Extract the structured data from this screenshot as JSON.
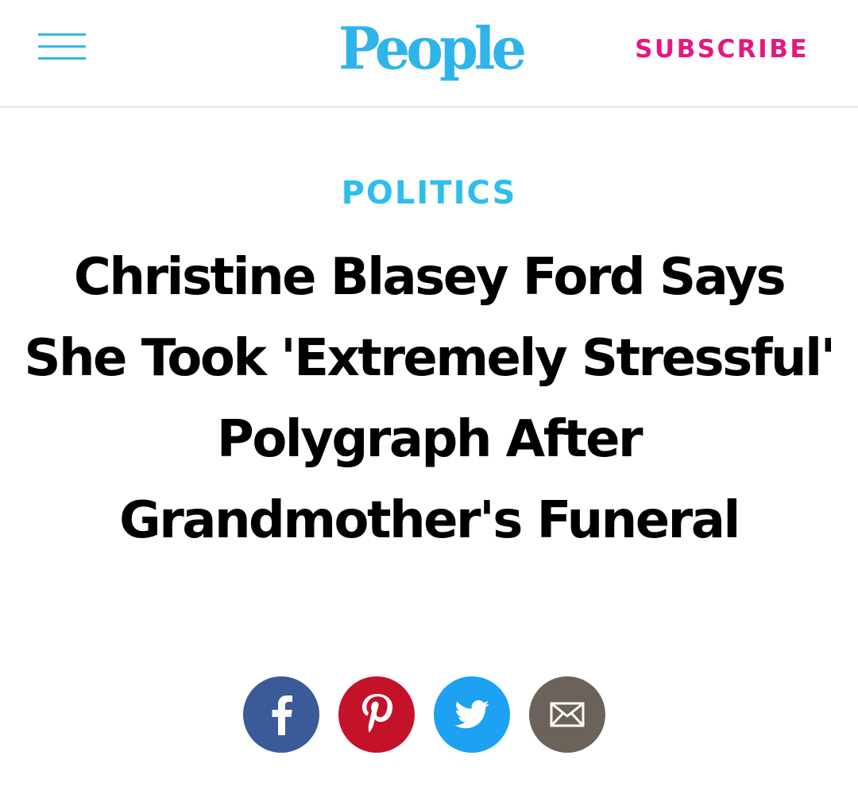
{
  "header": {
    "menu_icon": "hamburger-menu-icon",
    "logo_text": "People",
    "subscribe_label": "SUBSCRIBE",
    "colors": {
      "menu": "#35b7e8",
      "logo": "#2fb4ea",
      "subscribe": "#e6177e"
    }
  },
  "article": {
    "category": "POLITICS",
    "headline": "Christine Blasey Ford Says She Took 'Extremely Stressful' Polygraph After Grandmother's Funeral",
    "category_color": "#2fbdec"
  },
  "share": {
    "buttons": [
      {
        "icon": "facebook-icon",
        "color": "#3a5a98"
      },
      {
        "icon": "pinterest-icon",
        "color": "#c5122b"
      },
      {
        "icon": "twitter-icon",
        "color": "#1da1f2"
      },
      {
        "icon": "email-icon",
        "color": "#6b6259"
      }
    ]
  }
}
